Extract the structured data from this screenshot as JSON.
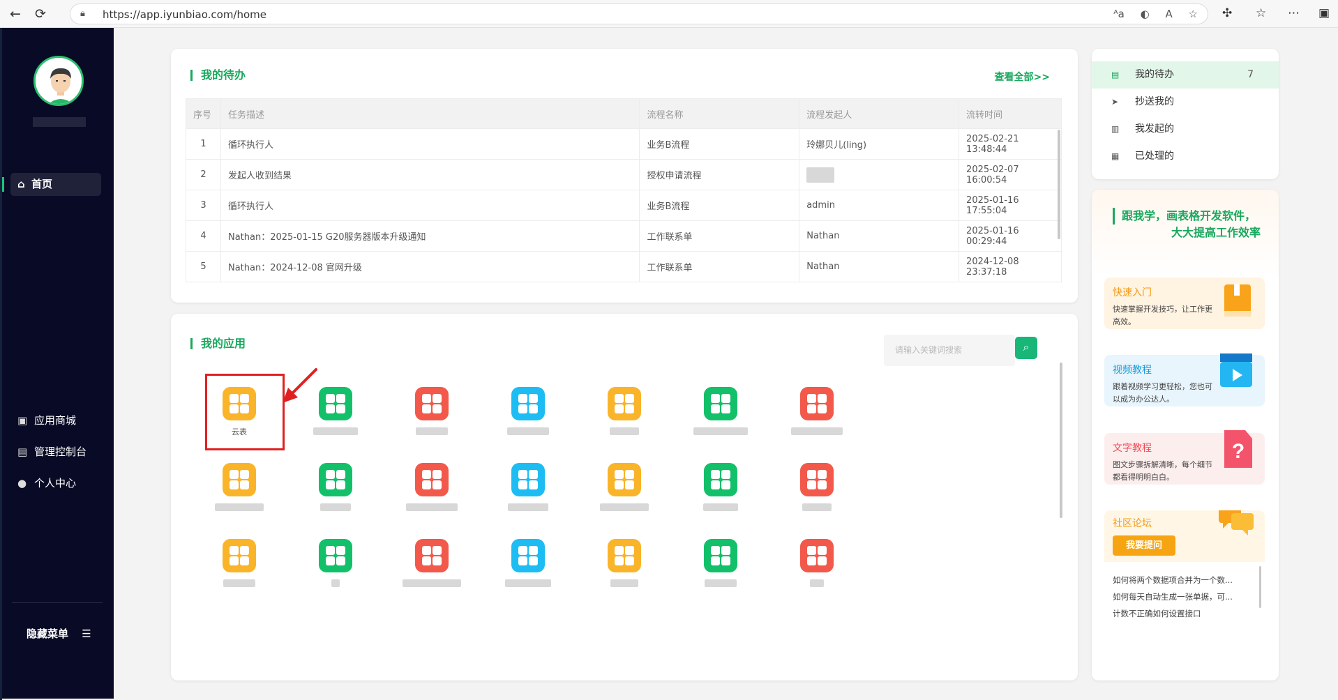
{
  "browser": {
    "url": "https://app.iyunbiao.com/home"
  },
  "sidebar": {
    "home_label": "首页",
    "items": [
      {
        "label": "应用商城",
        "icon": "shop-bag-icon"
      },
      {
        "label": "管理控制台",
        "icon": "console-icon"
      },
      {
        "label": "个人中心",
        "icon": "person-icon"
      }
    ],
    "hide_menu_label": "隐藏菜单"
  },
  "todo": {
    "title": "我的待办",
    "see_all": "查看全部>>",
    "columns": [
      "序号",
      "任务描述",
      "流程名称",
      "流程发起人",
      "流转时间"
    ],
    "rows": [
      {
        "no": "1",
        "desc": "循环执行人",
        "flow": "业务B流程",
        "initiator": "玲娜贝儿(ling)",
        "time": "2025-02-21 13:48:44"
      },
      {
        "no": "2",
        "desc": "发起人收到结果",
        "flow": "授权申请流程",
        "initiator": "",
        "time": "2025-02-07 16:00:54"
      },
      {
        "no": "3",
        "desc": "循环执行人",
        "flow": "业务B流程",
        "initiator": "admin",
        "time": "2025-01-16 17:55:04"
      },
      {
        "no": "4",
        "desc": "Nathan：2025-01-15 G20服务器版本升级通知",
        "flow": "工作联系单",
        "initiator": "Nathan",
        "time": "2025-01-16 00:29:44"
      },
      {
        "no": "5",
        "desc": "Nathan：2024-12-08 官网升级",
        "flow": "工作联系单",
        "initiator": "Nathan",
        "time": "2024-12-08 23:37:18"
      }
    ]
  },
  "apps": {
    "title": "我的应用",
    "search_placeholder": "请输入关键词搜索",
    "first_app_label": "云表",
    "colors": [
      "#f9b429",
      "#13c06a",
      "#f2594b",
      "#1dbdf3",
      "#f9b429",
      "#13c06a",
      "#f2594b"
    ]
  },
  "quick_menu": {
    "items": [
      {
        "label": "我的待办",
        "count": "7",
        "icon": "todo-doc-icon"
      },
      {
        "label": "抄送我的",
        "count": "",
        "icon": "send-plane-icon"
      },
      {
        "label": "我发起的",
        "count": "",
        "icon": "initiated-doc-icon"
      },
      {
        "label": "已处理的",
        "count": "",
        "icon": "clipboard-check-icon"
      }
    ]
  },
  "promo": {
    "headline_line1": "跟我学，画表格开发软件，",
    "headline_line2": "大大提高工作效率",
    "quick_start": {
      "title": "快速入门",
      "desc": "快速掌握开发技巧，让工作更高效。"
    },
    "video": {
      "title": "视频教程",
      "desc": "跟着视频学习更轻松，您也可以成为办公达人。"
    },
    "text": {
      "title": "文字教程",
      "desc": "图文步骤拆解清晰，每个细节都看得明明白白。"
    },
    "forum": {
      "title": "社区论坛",
      "ask_button": "我要提问",
      "posts": [
        "如何将两个数据项合并为一个数...",
        "如何每天自动生成一张单据，可...",
        "计数不正确如何设置接口"
      ]
    }
  }
}
